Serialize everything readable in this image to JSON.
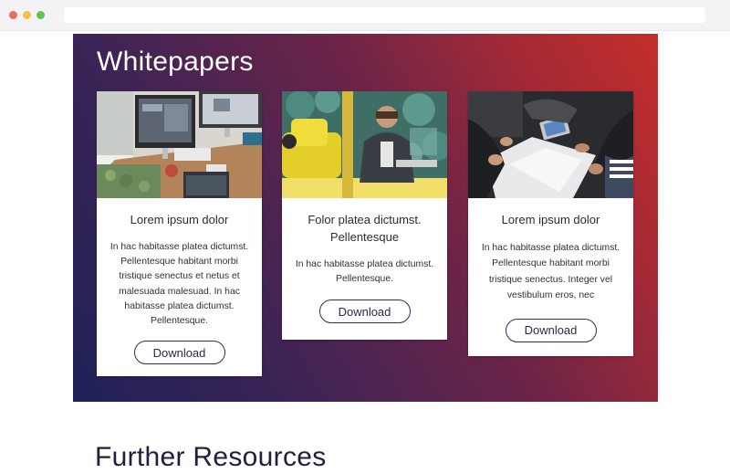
{
  "hero": {
    "title": "Whitepapers"
  },
  "cards": [
    {
      "title": "Lorem ipsum dolor",
      "text": "In hac habitasse platea dictumst. Pellentesque habitant morbi tristique senectus et netus et malesuada malesuad. In hac habitasse platea dictumst. Pellentesque.",
      "button": "Download",
      "image_icon": "desk-workspace-photo"
    },
    {
      "title": "Folor platea dictumst. Pellentesque",
      "text": "In hac habitasse platea dictumst. Pellentesque.",
      "button": "Download",
      "image_icon": "office-lounge-photo"
    },
    {
      "title": "Lorem ipsum dolor",
      "text": "In hac habitasse platea dictumst. Pellentesque habitant morbi tristique senectus. Integer vel vestibulum eros, nec",
      "button": "Download",
      "image_icon": "team-meeting-photo"
    }
  ],
  "section": {
    "heading": "Further Resources"
  },
  "colors": {
    "gradient_start": "#1f2157",
    "gradient_end": "#c22e2a",
    "button_border": "#2e2e55"
  }
}
